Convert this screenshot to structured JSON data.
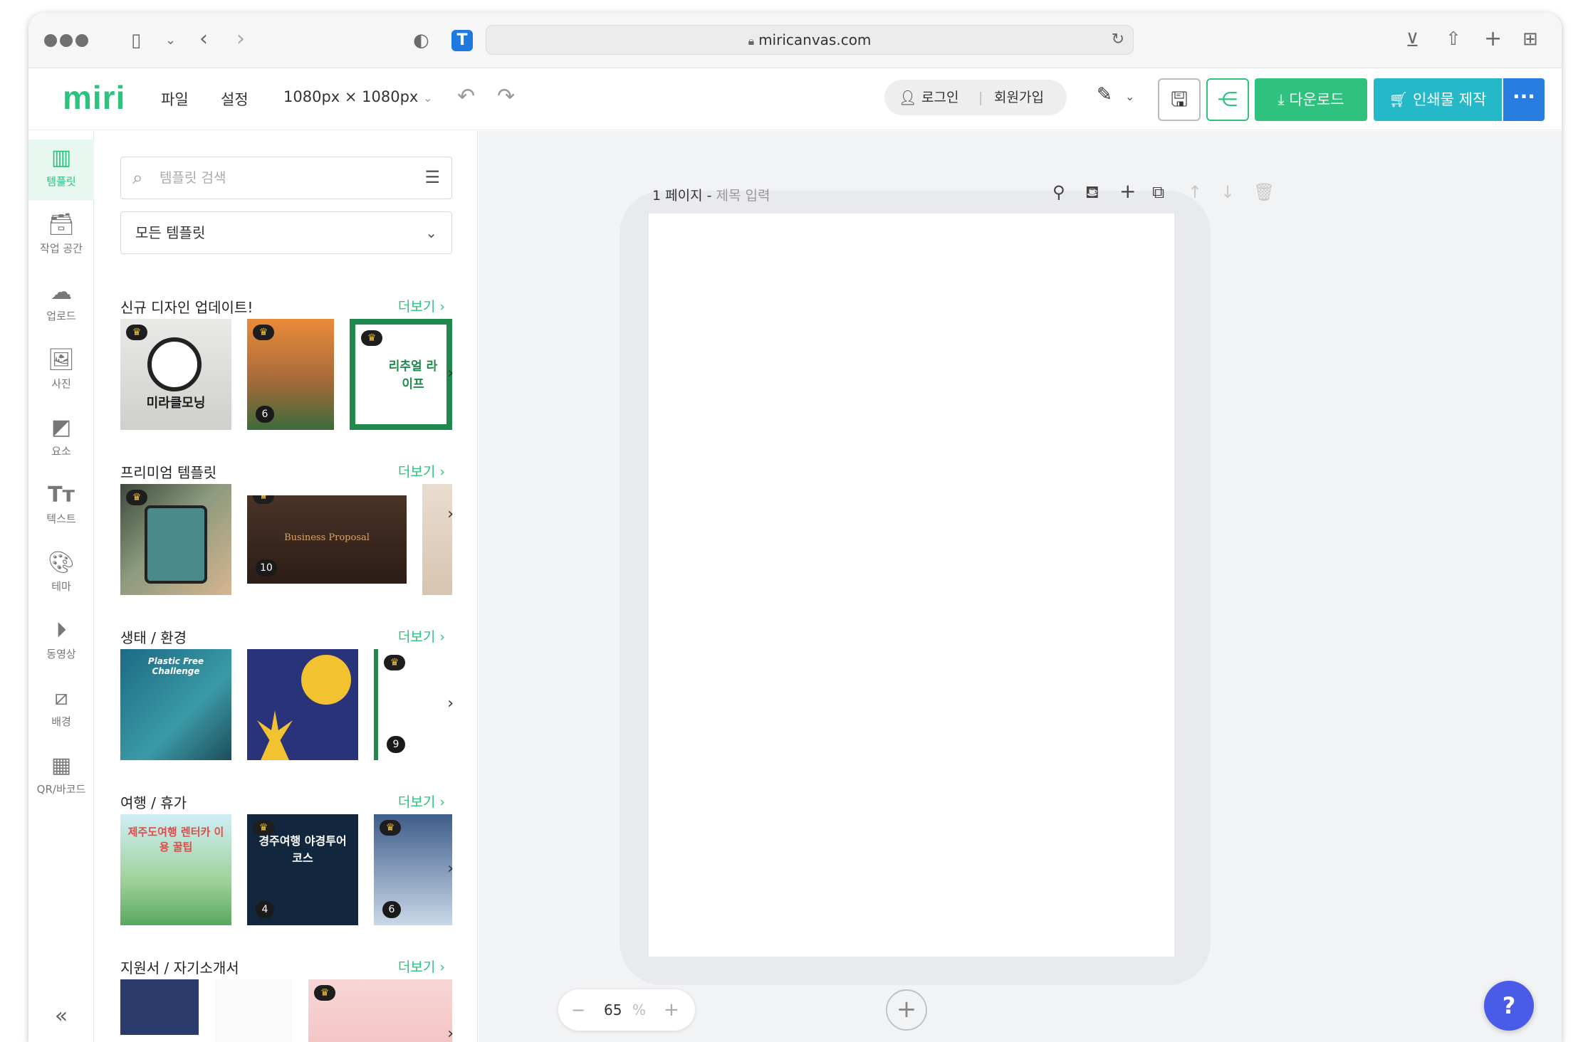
{
  "browser": {
    "url": "miricanvas.com"
  },
  "header": {
    "logo": "miri",
    "menu_file": "파일",
    "menu_settings": "설정",
    "size": "1080px × 1080px",
    "login": "로그인",
    "signup": "회원가입",
    "download": "다운로드",
    "print": "인쇄물 제작",
    "more": "···"
  },
  "sidebar": {
    "items": [
      {
        "label": "템플릿",
        "icon": "template-icon"
      },
      {
        "label": "작업 공간",
        "icon": "archive-icon"
      },
      {
        "label": "업로드",
        "icon": "cloud-upload-icon"
      },
      {
        "label": "사진",
        "icon": "image-icon"
      },
      {
        "label": "요소",
        "icon": "shapes-icon"
      },
      {
        "label": "텍스트",
        "icon": "text-icon"
      },
      {
        "label": "테마",
        "icon": "palette-icon"
      },
      {
        "label": "동영상",
        "icon": "play-icon"
      },
      {
        "label": "배경",
        "icon": "background-icon"
      },
      {
        "label": "QR/바코드",
        "icon": "qr-icon"
      }
    ]
  },
  "panel": {
    "search_placeholder": "템플릿 검색",
    "filter_selected": "모든 템플릿",
    "more_label": "더보기",
    "sections": [
      {
        "title": "신규 디자인 업데이트!",
        "thumbs": [
          {
            "text": "미라클모닝",
            "count": ""
          },
          {
            "text": "",
            "count": "6"
          },
          {
            "text": "리추얼 라이프",
            "count": ""
          }
        ]
      },
      {
        "title": "프리미엄 템플릿",
        "thumbs": [
          {
            "text": "",
            "count": ""
          },
          {
            "text": "Business Proposal",
            "count": "10"
          },
          {
            "text": "",
            "count": ""
          }
        ]
      },
      {
        "title": "생태 / 환경",
        "thumbs": [
          {
            "text": "Plastic Free Challenge",
            "count": ""
          },
          {
            "text": "",
            "count": ""
          },
          {
            "text": "",
            "count": "9"
          }
        ]
      },
      {
        "title": "여행 / 휴가",
        "thumbs": [
          {
            "text": "제주도여행 렌터카 이용 꿀팁",
            "count": ""
          },
          {
            "text": "경주여행 야경투어코스",
            "count": "4"
          },
          {
            "text": "",
            "count": "6"
          }
        ]
      },
      {
        "title": "지원서 / 자기소개서",
        "thumbs": [
          {
            "text": "",
            "count": ""
          },
          {
            "text": "",
            "count": ""
          },
          {
            "text": "",
            "count": ""
          }
        ]
      }
    ]
  },
  "canvas": {
    "page_label": "1 페이지 -",
    "page_title_placeholder": "제목 입력",
    "zoom_value": "65",
    "zoom_unit": "%"
  },
  "colors": {
    "brand": "#2ec27e",
    "print": "#25b8c9",
    "more": "#2a7de0",
    "help": "#4a5be8"
  }
}
